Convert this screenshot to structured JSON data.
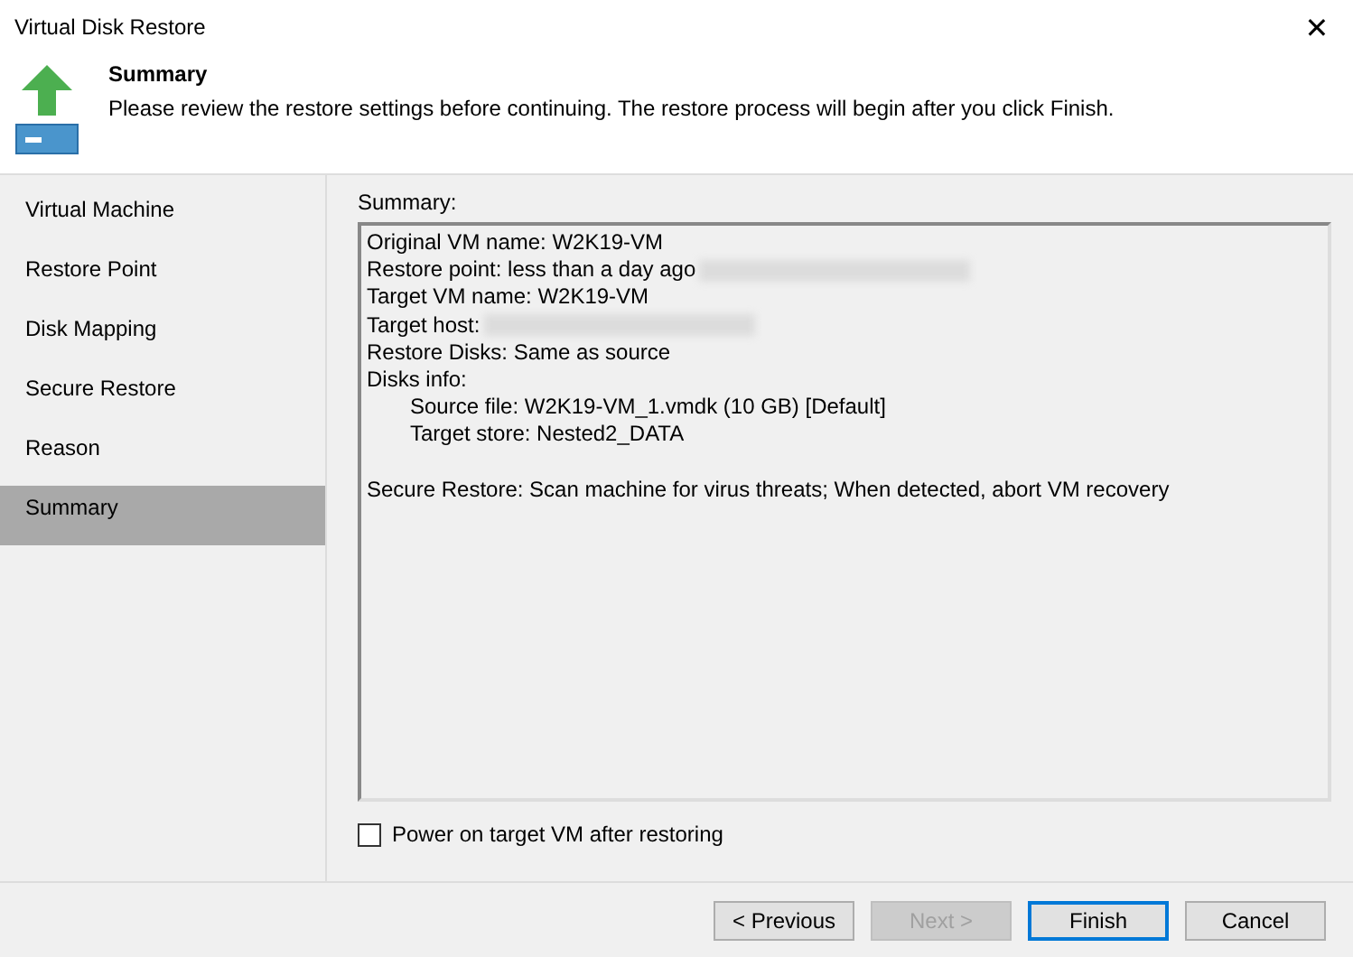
{
  "window": {
    "title": "Virtual Disk Restore",
    "close": "✕"
  },
  "header": {
    "title": "Summary",
    "description": "Please review the restore settings before continuing. The restore process will begin after you click Finish."
  },
  "sidebar": {
    "items": [
      {
        "label": "Virtual Machine",
        "selected": false
      },
      {
        "label": "Restore Point",
        "selected": false
      },
      {
        "label": "Disk Mapping",
        "selected": false
      },
      {
        "label": "Secure Restore",
        "selected": false
      },
      {
        "label": "Reason",
        "selected": false
      },
      {
        "label": "Summary",
        "selected": true
      }
    ]
  },
  "summary": {
    "label": "Summary:",
    "lines": [
      {
        "text": "Original VM name: W2K19-VM",
        "redacted": false
      },
      {
        "text": "Restore point: less than a day ago",
        "redacted": true
      },
      {
        "text": "Target VM name: W2K19-VM",
        "redacted": false
      },
      {
        "text": "Target host:",
        "redacted": true
      },
      {
        "text": "Restore Disks: Same as source",
        "redacted": false
      },
      {
        "text": "Disks info:",
        "redacted": false,
        "children": [
          {
            "text": "Source file: W2K19-VM_1.vmdk (10 GB) [Default]",
            "redacted": false
          },
          {
            "text": "Target store: Nested2_DATA",
            "redacted": false
          }
        ]
      }
    ],
    "note": "Secure Restore: Scan machine for virus threats; When detected, abort VM recovery"
  },
  "power_on": {
    "label": "Power on target VM after restoring",
    "checked": false
  },
  "buttons": [
    {
      "label": "< Previous",
      "disabled": false,
      "selected": false
    },
    {
      "label": "Next >",
      "disabled": true,
      "selected": false
    },
    {
      "label": "Finish",
      "disabled": false,
      "selected": true
    },
    {
      "label": "Cancel",
      "disabled": false,
      "selected": false
    }
  ]
}
